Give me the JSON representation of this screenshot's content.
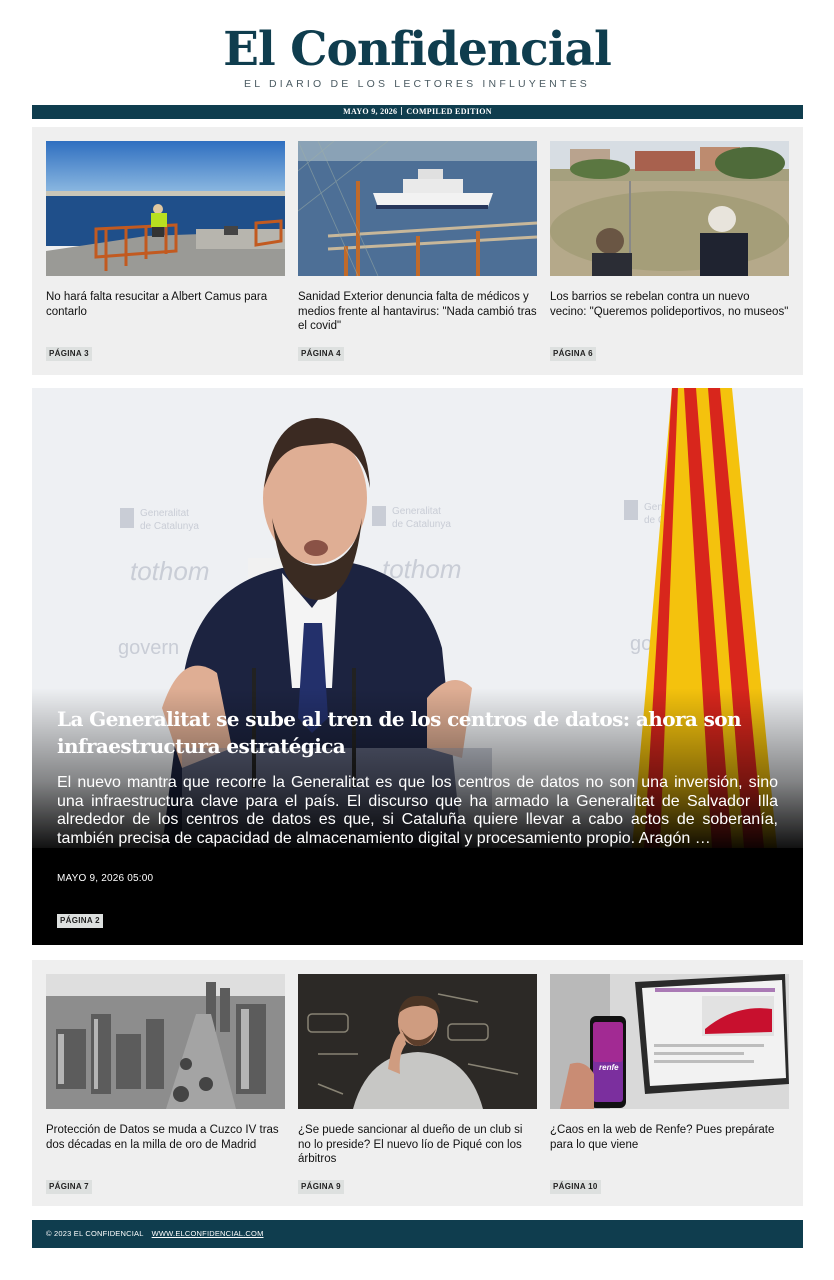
{
  "masthead": {
    "logo": "El Confidencial",
    "tagline": "EL DIARIO DE LOS LECTORES INFLUYENTES",
    "date": "MAYO 9, 2026",
    "edition": "COMPILED EDITION"
  },
  "top_cards": [
    {
      "headline": "No hará falta resucitar a Albert Camus para contarlo",
      "page": "PÁGINA 3"
    },
    {
      "headline": "Sanidad Exterior denuncia falta de médicos y medios frente al hantavirus: \"Nada cambió tras el covid\"",
      "page": "PÁGINA 4"
    },
    {
      "headline": "Los barrios se rebelan contra un nuevo vecino: \"Queremos polideportivos, no museos\"",
      "page": "PÁGINA 6"
    }
  ],
  "hero": {
    "title": "La Generalitat se sube al tren de los centros de datos: ahora son infraestructura estratégica",
    "summary": "El nuevo mantra que recorre la Generalitat es que los centros de datos no son una inversión, sino una infraestructura clave para el país. El discurso que ha armado la Generalitat de Salvador Illa alrededor de los centros de datos es que, si Cataluña quiere llevar a cabo actos de soberanía, también precisa de capacidad de almacenamiento digital y procesamiento propio. Aragón …",
    "date": "MAYO 9, 2026 05:00",
    "page": "PÁGINA 2",
    "backdrop_text": [
      "Generalitat",
      "de Catalunya",
      "tothom",
      "govern"
    ]
  },
  "bottom_cards": [
    {
      "headline": "Protección de Datos se muda a Cuzco IV tras dos décadas en la milla de oro de Madrid",
      "page": "PÁGINA 7"
    },
    {
      "headline": "¿Se puede sancionar al dueño de un club si no lo preside? El nuevo lío de Piqué con los árbitros",
      "page": "PÁGINA 9"
    },
    {
      "headline": "¿Caos en la web de Renfe? Pues prepárate para lo que viene",
      "page": "PÁGINA 10",
      "phone_text": "renfe"
    }
  ],
  "footer": {
    "copyright": "© 2023 EL CONFIDENCIAL",
    "link": "WWW.ELCONFIDENCIAL.COM"
  },
  "colors": {
    "brand": "#0f3d4e",
    "panel": "#efefef",
    "tag": "#dde0df"
  }
}
